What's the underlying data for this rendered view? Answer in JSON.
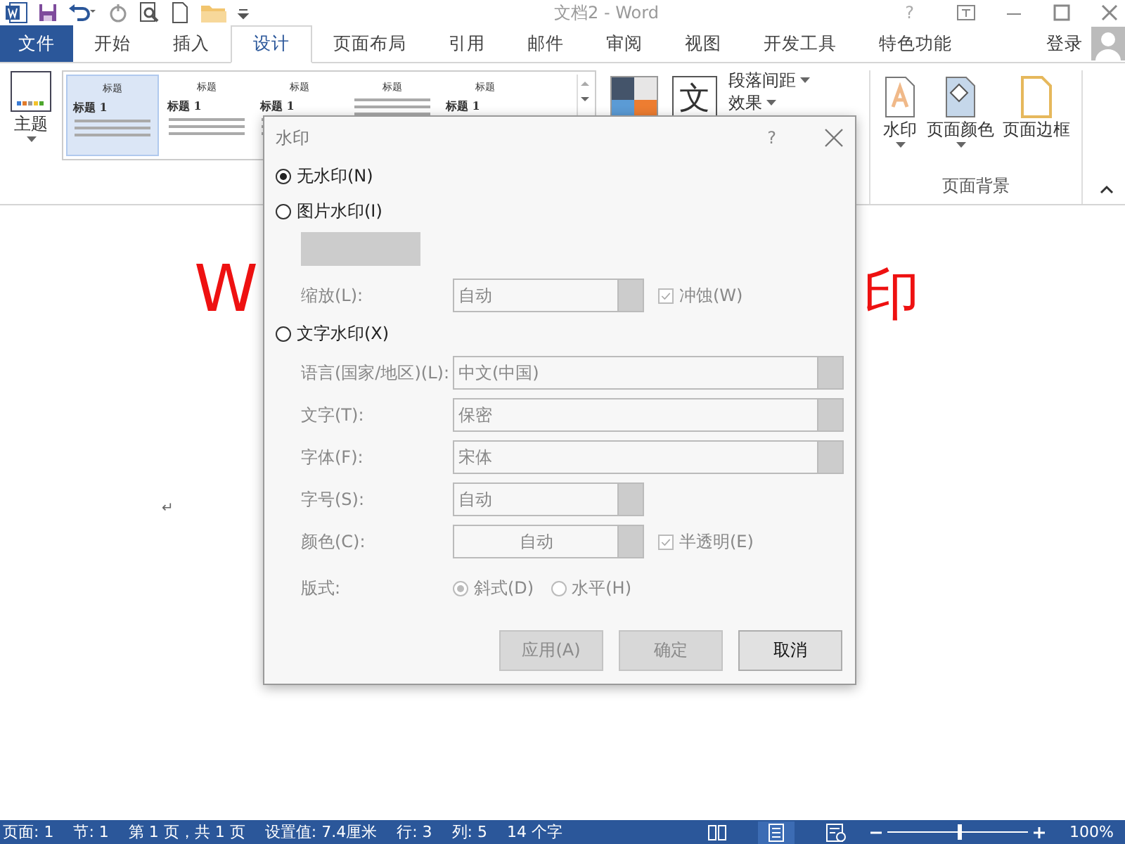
{
  "title_bar": {
    "title": "文档2 - Word",
    "help": "?"
  },
  "tabs": [
    {
      "label": "文件",
      "kind": "file",
      "selected": false
    },
    {
      "label": "开始",
      "kind": "tab",
      "selected": false
    },
    {
      "label": "插入",
      "kind": "tab",
      "selected": false
    },
    {
      "label": "设计",
      "kind": "tab",
      "selected": true
    },
    {
      "label": "页面布局",
      "kind": "tab",
      "selected": false
    },
    {
      "label": "引用",
      "kind": "tab",
      "selected": false
    },
    {
      "label": "邮件",
      "kind": "tab",
      "selected": false
    },
    {
      "label": "审阅",
      "kind": "tab",
      "selected": false
    },
    {
      "label": "视图",
      "kind": "tab",
      "selected": false
    },
    {
      "label": "开发工具",
      "kind": "tab",
      "selected": false
    },
    {
      "label": "特色功能",
      "kind": "tab",
      "selected": false
    }
  ],
  "account": "登录",
  "ribbon": {
    "theme": "主题",
    "styles": [
      {
        "title": "标题",
        "heading": "标题 1",
        "selected": true
      },
      {
        "title": "标题",
        "heading": "标题 1",
        "selected": false
      },
      {
        "title": "标题",
        "heading": "标题 1",
        "selected": false
      },
      {
        "title": "标题",
        "selected": false
      },
      {
        "title": "标题",
        "heading": "标题 1",
        "selected": false
      }
    ],
    "fonts": "文",
    "paragraph_spacing": "段落间距",
    "effects": "效果",
    "page_background": [
      "水印",
      "页面颜色",
      "页面边框"
    ],
    "group_label": "页面背景"
  },
  "document": {
    "left_fragment": "W",
    "right_fragment": "印",
    "paragraph_mark": "↵"
  },
  "dialog": {
    "title": "水印",
    "help": "?",
    "options": [
      {
        "label": "无水印(N)",
        "selected": true
      },
      {
        "label": "图片水印(I)",
        "selected": false
      }
    ],
    "scale": {
      "label": "缩放(L):",
      "value": "自动",
      "disabled": true
    },
    "washout": {
      "label": "冲蚀(W)",
      "checked": true,
      "disabled": true
    },
    "text_option": {
      "label": "文字水印(X)",
      "selected": false
    },
    "fields": [
      {
        "label": "语言(国家/地区)(L):",
        "value": "中文(中国)",
        "kind": "wide",
        "disabled": true
      },
      {
        "label": "文字(T):",
        "value": "保密",
        "kind": "wide",
        "disabled": true
      },
      {
        "label": "字体(F):",
        "value": "宋体",
        "kind": "wide",
        "disabled": true
      },
      {
        "label": "字号(S):",
        "value": "自动",
        "kind": "narrow",
        "disabled": true
      },
      {
        "label": "颜色(C):",
        "value": "自动",
        "kind": "centered",
        "disabled": true
      }
    ],
    "semitransparent": {
      "label": "半透明(E)",
      "checked": true,
      "disabled": true
    },
    "layout": {
      "label": "版式:",
      "options": [
        {
          "label": "斜式(D)",
          "selected": true
        },
        {
          "label": "水平(H)",
          "selected": false
        }
      ],
      "disabled": true
    },
    "buttons": [
      {
        "label": "应用(A)",
        "disabled": true
      },
      {
        "label": "确定",
        "disabled": true
      },
      {
        "label": "取消",
        "disabled": false
      }
    ]
  },
  "status_bar": {
    "items": [
      "页面: 1",
      "节: 1",
      "第 1 页，共 1 页",
      "设置值: 7.4厘米",
      "行: 3",
      "列: 5",
      "14 个字"
    ],
    "zoom": {
      "level": 0.5,
      "reading": "100%"
    }
  }
}
